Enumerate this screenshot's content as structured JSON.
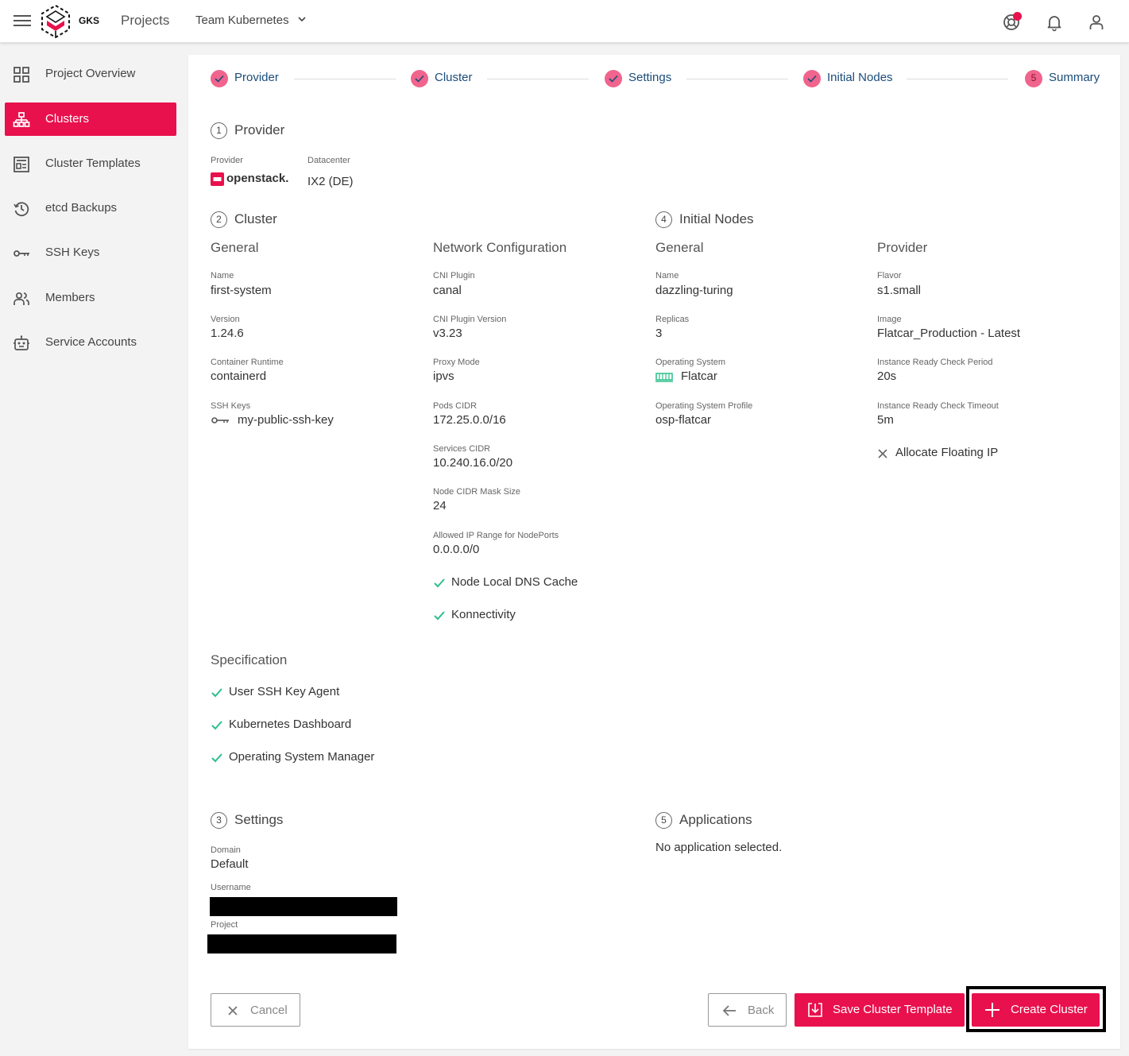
{
  "topbar": {
    "logo_text": "GKS",
    "projects": "Projects",
    "project_select": "Team Kubernetes"
  },
  "sidebar": {
    "items": [
      {
        "label": "Project Overview"
      },
      {
        "label": "Clusters"
      },
      {
        "label": "Cluster Templates"
      },
      {
        "label": "etcd Backups"
      },
      {
        "label": "SSH Keys"
      },
      {
        "label": "Members"
      },
      {
        "label": "Service Accounts"
      }
    ],
    "active_index": 1
  },
  "stepper": {
    "steps": [
      {
        "label": "Provider",
        "state": "done"
      },
      {
        "label": "Cluster",
        "state": "done"
      },
      {
        "label": "Settings",
        "state": "done"
      },
      {
        "label": "Initial Nodes",
        "state": "done"
      },
      {
        "label": "Summary",
        "state": "current",
        "number": "5"
      }
    ]
  },
  "provider_section": {
    "number": "1",
    "title": "Provider",
    "provider_label": "Provider",
    "provider_logo_text": "openstack.",
    "datacenter_label": "Datacenter",
    "datacenter_value": "IX2 (DE)"
  },
  "cluster_section": {
    "number": "2",
    "title": "Cluster",
    "general": {
      "title": "General",
      "name_label": "Name",
      "name": "first-system",
      "version_label": "Version",
      "version": "1.24.6",
      "runtime_label": "Container Runtime",
      "runtime": "containerd",
      "ssh_label": "SSH Keys",
      "ssh_key": "my-public-ssh-key"
    },
    "network": {
      "title": "Network Configuration",
      "cni_label": "CNI Plugin",
      "cni": "canal",
      "cni_version_label": "CNI Plugin Version",
      "cni_version": "v3.23",
      "proxy_label": "Proxy Mode",
      "proxy": "ipvs",
      "pods_label": "Pods CIDR",
      "pods": "172.25.0.0/16",
      "services_label": "Services CIDR",
      "services": "10.240.16.0/20",
      "mask_label": "Node CIDR Mask Size",
      "mask": "24",
      "range_label": "Allowed IP Range for NodePorts",
      "range": "0.0.0.0/0",
      "dns_cache": "Node Local DNS Cache",
      "konnectivity": "Konnectivity"
    },
    "specification": {
      "title": "Specification",
      "items": [
        "User SSH Key Agent",
        "Kubernetes Dashboard",
        "Operating System Manager"
      ]
    }
  },
  "nodes_section": {
    "number": "4",
    "title": "Initial Nodes",
    "general": {
      "title": "General",
      "name_label": "Name",
      "name": "dazzling-turing",
      "replicas_label": "Replicas",
      "replicas": "3",
      "os_label": "Operating System",
      "os": "Flatcar",
      "osp_label": "Operating System Profile",
      "osp": "osp-flatcar"
    },
    "provider": {
      "title": "Provider",
      "flavor_label": "Flavor",
      "flavor": "s1.small",
      "image_label": "Image",
      "image": "Flatcar_Production - Latest",
      "period_label": "Instance Ready Check Period",
      "period": "20s",
      "timeout_label": "Instance Ready Check Timeout",
      "timeout": "5m",
      "floating_ip": "Allocate Floating IP"
    }
  },
  "settings_section": {
    "number": "3",
    "title": "Settings",
    "domain_label": "Domain",
    "domain": "Default",
    "username_label": "Username",
    "project_label": "Project"
  },
  "applications_section": {
    "number": "5",
    "title": "Applications",
    "empty": "No application selected."
  },
  "actions": {
    "cancel": "Cancel",
    "back": "Back",
    "save_template": "Save Cluster Template",
    "create": "Create Cluster"
  },
  "colors": {
    "accent": "#e8114d",
    "step_done": "#f0648d",
    "link": "#1a4c7a",
    "check": "#2cbf8a"
  }
}
